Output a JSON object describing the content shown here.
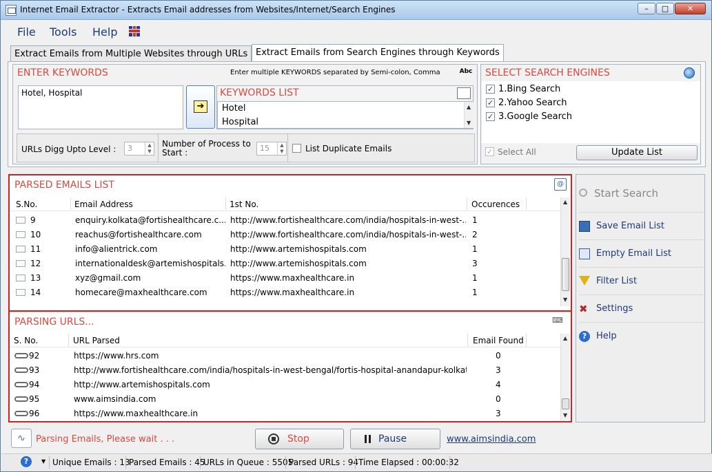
{
  "window": {
    "title": "Internet Email Extractor - Extracts Email addresses from Websites/Internet/Search Engines",
    "min": "–",
    "max": "□",
    "close": "✕"
  },
  "menu": {
    "file": "File",
    "tools": "Tools",
    "help": "Help"
  },
  "tabs": {
    "tab1": "Extract Emails from Multiple Websites through URLs",
    "tab2": "Extract Emails from Search Engines through Keywords"
  },
  "keywords": {
    "title": "ENTER KEYWORDS",
    "hint": "Enter multiple KEYWORDS separated by Semi-colon, Comma",
    "value": "Hotel, Hospital",
    "list_title": "KEYWORDS LIST",
    "list": [
      "Hotel",
      "Hospital"
    ],
    "digg_label": "URLs Digg Upto Level :",
    "digg_value": "3",
    "process_label_1": "Number of Process to",
    "process_label_2": "Start :",
    "process_value": "15",
    "duplicate_label": "List Duplicate Emails"
  },
  "engines": {
    "title": "SELECT SEARCH ENGINES",
    "items": [
      "1.Bing Search",
      "2.Yahoo Search",
      "3.Google Search"
    ],
    "select_all": "Select All",
    "update": "Update List"
  },
  "emails": {
    "title": "PARSED EMAILS LIST",
    "headers": {
      "sno": "S.No.",
      "email": "Email Address",
      "first": "1st No.",
      "occ": "Occurences"
    },
    "rows": [
      {
        "sno": "9",
        "email": "enquiry.kolkata@fortishealthcare.c...",
        "url": "http://www.fortishealthcare.com/india/hospitals-in-west-...",
        "occ": "1"
      },
      {
        "sno": "10",
        "email": "reachus@fortishealthcare.com",
        "url": "http://www.fortishealthcare.com/india/hospitals-in-west-...",
        "occ": "2"
      },
      {
        "sno": "11",
        "email": "info@alientrick.com",
        "url": "http://www.artemishospitals.com",
        "occ": "1"
      },
      {
        "sno": "12",
        "email": "internationaldesk@artemishospitals...",
        "url": "http://www.artemishospitals.com",
        "occ": "3"
      },
      {
        "sno": "13",
        "email": "xyz@gmail.com",
        "url": "https://www.maxhealthcare.in",
        "occ": "1"
      },
      {
        "sno": "14",
        "email": "homecare@maxhealthcare.com",
        "url": "https://www.maxhealthcare.in",
        "occ": "1"
      }
    ]
  },
  "urls": {
    "title": "PARSING URLS...",
    "headers": {
      "sno": "S. No.",
      "url": "URL Parsed",
      "found": "Email Found"
    },
    "rows": [
      {
        "sno": "92",
        "url": "https://www.hrs.com",
        "found": "0"
      },
      {
        "sno": "93",
        "url": "http://www.fortishealthcare.com/india/hospitals-in-west-bengal/fortis-hospital-anandapur-kolkata",
        "found": "3"
      },
      {
        "sno": "94",
        "url": "http://www.artemishospitals.com",
        "found": "4"
      },
      {
        "sno": "95",
        "url": "www.aimsindia.com",
        "found": "0"
      },
      {
        "sno": "96",
        "url": "https://www.maxhealthcare.in",
        "found": "3"
      }
    ]
  },
  "side": {
    "start": "Start Search",
    "save": "Save Email List",
    "empty": "Empty Email List",
    "filter": "Filter List",
    "settings": "Settings",
    "help": "Help"
  },
  "bottom": {
    "status": "Parsing Emails, Please wait . . .",
    "stop": "Stop",
    "pause": "Pause",
    "link": "www.aimsindia.com"
  },
  "statusbar": {
    "unique": "Unique Emails : 13",
    "parsed": "Parsed Emails : 45",
    "queue": "URLs in Queue : 5505",
    "parsed_urls": "Parsed URLs : 94",
    "elapsed": "Time Elapsed : 00:00:32"
  },
  "colors": {
    "accent_red": "#d8493e",
    "link_blue": "#1c3a78"
  }
}
